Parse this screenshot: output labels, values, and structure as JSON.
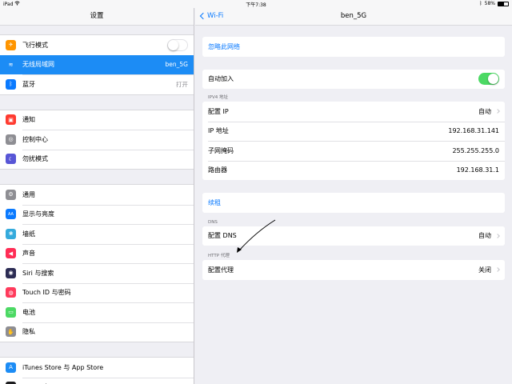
{
  "status_bar": {
    "device": "iPad",
    "time": "下午7:38",
    "battery": "58%"
  },
  "left_pane": {
    "title": "设置",
    "groups": [
      {
        "items": [
          {
            "label": "飞行模式",
            "icon": "airplane-icon",
            "color": "#ff9500",
            "glyph": "✈",
            "toggle": "off"
          },
          {
            "label": "无线局域网",
            "icon": "wifi-icon",
            "color": "#1c8cf5",
            "glyph": "≋",
            "value": "ben_5G",
            "selected": true
          },
          {
            "label": "蓝牙",
            "icon": "bluetooth-icon",
            "color": "#0a7aff",
            "glyph": "ᛒ",
            "value": "打开"
          }
        ]
      },
      {
        "items": [
          {
            "label": "通知",
            "icon": "notifications-icon",
            "color": "#ff3b30",
            "glyph": "▣"
          },
          {
            "label": "控制中心",
            "icon": "control-center-icon",
            "color": "#8e8e93",
            "glyph": "◎"
          },
          {
            "label": "勿扰模式",
            "icon": "moon-icon",
            "color": "#5856d6",
            "glyph": "☾"
          }
        ]
      },
      {
        "items": [
          {
            "label": "通用",
            "icon": "gear-icon",
            "color": "#8e8e93",
            "glyph": "⚙"
          },
          {
            "label": "显示与亮度",
            "icon": "display-icon",
            "color": "#0a7aff",
            "glyph": "AA"
          },
          {
            "label": "墙纸",
            "icon": "wallpaper-icon",
            "color": "#34aadc",
            "glyph": "❀"
          },
          {
            "label": "声音",
            "icon": "sound-icon",
            "color": "#ff2d55",
            "glyph": "◀"
          },
          {
            "label": "Siri 与搜索",
            "icon": "siri-icon",
            "color": "#2c2c54",
            "glyph": "◉"
          },
          {
            "label": "Touch ID 与密码",
            "icon": "fingerprint-icon",
            "color": "#ff3b5c",
            "glyph": "◍"
          },
          {
            "label": "电池",
            "icon": "battery-icon",
            "color": "#4cd964",
            "glyph": "▭"
          },
          {
            "label": "隐私",
            "icon": "hand-icon",
            "color": "#8e8e93",
            "glyph": "✋"
          }
        ]
      },
      {
        "items": [
          {
            "label": "iTunes Store 与 App Store",
            "icon": "app-store-icon",
            "color": "#1c8cf5",
            "glyph": "A"
          },
          {
            "label": "Wallet 与 Apple Pay",
            "icon": "wallet-icon",
            "color": "#1c1c1e",
            "glyph": "▤"
          }
        ]
      }
    ]
  },
  "right_pane": {
    "back_label": "Wi-Fi",
    "title": "ben_5G",
    "forget_label": "忽略此网络",
    "auto_join": {
      "label": "自动加入",
      "toggle": "on"
    },
    "ipv4": {
      "section_title": "IPV4 地址",
      "rows": [
        {
          "label": "配置 IP",
          "value": "自动",
          "chevron": true
        },
        {
          "label": "IP 地址",
          "value": "192.168.31.141"
        },
        {
          "label": "子网掩码",
          "value": "255.255.255.0"
        },
        {
          "label": "路由器",
          "value": "192.168.31.1"
        }
      ]
    },
    "renew_label": "续租",
    "dns": {
      "section_title": "DNS",
      "rows": [
        {
          "label": "配置 DNS",
          "value": "自动",
          "chevron": true
        }
      ]
    },
    "proxy": {
      "section_title": "HTTP 代理",
      "rows": [
        {
          "label": "配置代理",
          "value": "关闭",
          "chevron": true
        }
      ]
    }
  }
}
